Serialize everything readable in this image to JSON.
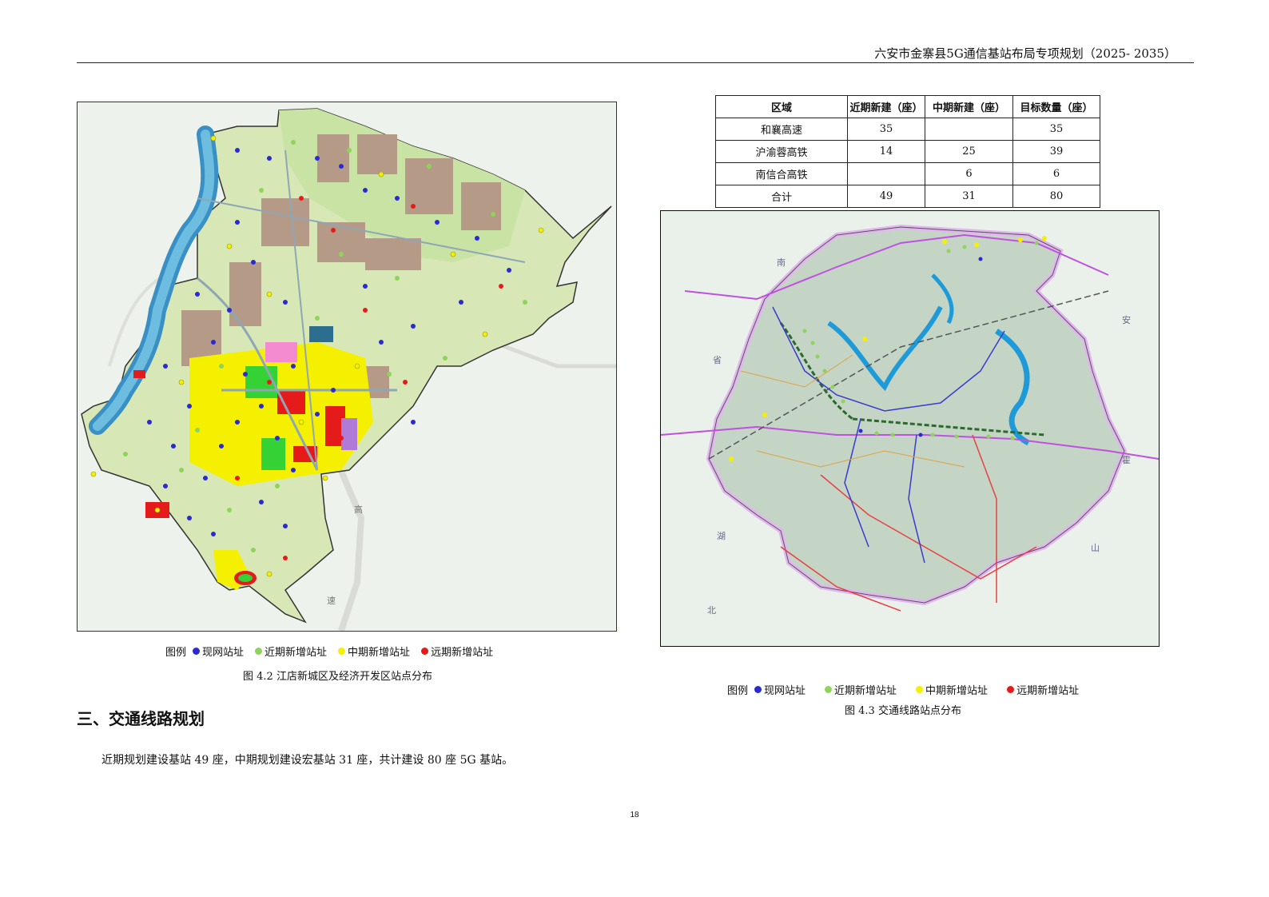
{
  "header": {
    "title": "六安市金寨县5G通信基站布局专项规划（2025- 2035）"
  },
  "figure_1": {
    "caption": "图 4.2    江店新城区及经济开发区站点分布",
    "legend_label": "图例",
    "legend": [
      {
        "label": "现网站址",
        "color": "#2a2ad0"
      },
      {
        "label": "近期新增站址",
        "color": "#8fd45a"
      },
      {
        "label": "中期新增站址",
        "color": "#f5f000"
      },
      {
        "label": "远期新增站址",
        "color": "#e51a1a"
      }
    ],
    "map_text": [
      "高",
      "速"
    ]
  },
  "table": {
    "headers": [
      "区域",
      "近期新建（座）",
      "中期新建（座）",
      "目标数量（座）"
    ],
    "rows": [
      [
        "和襄高速",
        "35",
        "",
        "35"
      ],
      [
        "沪渝蓉高铁",
        "14",
        "25",
        "39"
      ],
      [
        "南信合高铁",
        "",
        "6",
        "6"
      ],
      [
        "合计",
        "49",
        "31",
        "80"
      ]
    ]
  },
  "figure_2": {
    "caption": "图 4.3    交通线路站点分布",
    "legend_label": "图例",
    "legend": [
      {
        "label": "现网站址",
        "color": "#2a2ad0"
      },
      {
        "label": "近期新增站址",
        "color": "#8fd45a"
      },
      {
        "label": "中期新增站址",
        "color": "#f5f000"
      },
      {
        "label": "远期新增站址",
        "color": "#e51a1a"
      }
    ],
    "map_text": [
      "南",
      "省",
      "安",
      "霍",
      "山",
      "湖",
      "北"
    ]
  },
  "section": {
    "heading": "三、交通线路规划",
    "body": "近期规划建设基站 49 座，中期规划建设宏基站 31 座，共计建设 80 座 5G 基站。"
  },
  "page_number": "18"
}
